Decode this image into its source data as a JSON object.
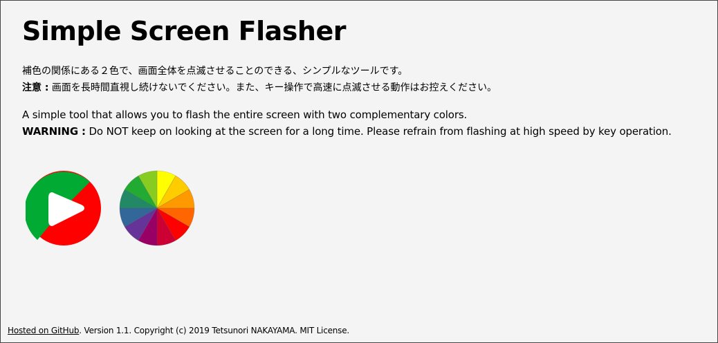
{
  "page": {
    "title": "Simple Screen Flasher"
  },
  "description_ja": {
    "line1": "補色の関係にある２色で、画面全体を点滅させることのできる、シンプルなツールです。",
    "warning_label": "注意 :",
    "warning_text": " 画面を長時間直視し続けないでください。また、キー操作で高速に点滅させる動作はお控えください。"
  },
  "description_en": {
    "line1": "A simple tool that allows you to flash the entire screen with two complementary colors.",
    "warning_label": "WARNING :",
    "warning_text": " Do NOT keep on looking at the screen for a long time. Please refrain from flashing at high speed by key operation."
  },
  "controls": {
    "play_button": {
      "icon": "play-icon",
      "colors": [
        "#00aa33",
        "#ff0000"
      ]
    },
    "color_wheel_button": {
      "icon": "color-wheel-icon",
      "colors": [
        "#ffff00",
        "#ffcc00",
        "#ff9900",
        "#ff6600",
        "#ff0000",
        "#cc0033",
        "#990066",
        "#663399",
        "#336699",
        "#228866",
        "#22aa33",
        "#88cc22"
      ]
    }
  },
  "footer": {
    "link_text": "Hosted on GitHub",
    "text": ". Version 1.1. Copyright (c) 2019 Tetsunori NAKAYAMA. MIT License."
  }
}
